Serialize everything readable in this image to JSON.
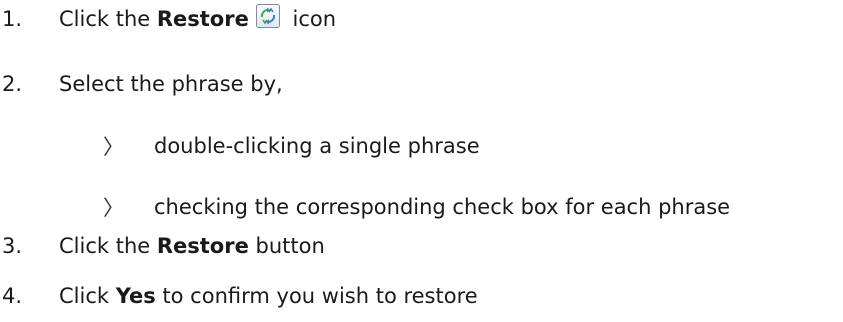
{
  "steps": [
    {
      "number": "1.",
      "before": "Click the ",
      "bold": "Restore",
      "after": " icon",
      "icon": "restore-recycle-icon"
    },
    {
      "number": "2.",
      "text": "Select the phrase by,"
    },
    {
      "number": "3.",
      "before": "Click the ",
      "bold": "Restore",
      "after": " button"
    },
    {
      "number": "4.",
      "before": "Click ",
      "bold": "Yes",
      "after": " to confirm you wish to restore"
    }
  ],
  "sub_bullets": [
    {
      "marker": "〉",
      "text": "double-clicking a single phrase"
    },
    {
      "marker": "〉",
      "text": "checking the corresponding check box for each phrase"
    }
  ],
  "colors": {
    "text": "#1a1a1a",
    "icon_blue": "#3a7fc9",
    "icon_green": "#3aa55a"
  }
}
